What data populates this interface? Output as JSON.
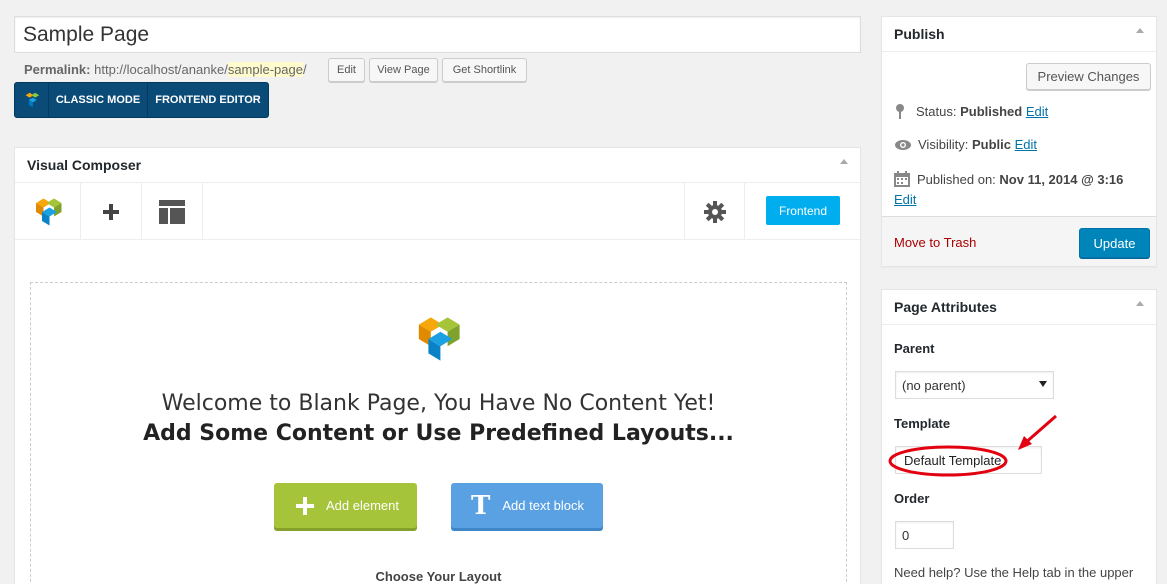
{
  "post": {
    "title": "Sample Page",
    "permalink_label": "Permalink:",
    "permalink_base": "http://localhost/ananke/",
    "permalink_slug": "sample-page",
    "permalink_end": "/",
    "edit_btn": "Edit",
    "view_btn": "View Page",
    "shortlink_btn": "Get Shortlink"
  },
  "mode_switch": {
    "classic": "CLASSIC MODE",
    "frontend": "FRONTEND EDITOR"
  },
  "vc": {
    "title": "Visual Composer",
    "frontend_btn": "Frontend",
    "welcome_line1": "Welcome to Blank Page, You Have No Content Yet!",
    "welcome_line2": "Add Some Content or Use Predefined Layouts...",
    "add_element": "Add element",
    "add_text_block": "Add text block",
    "choose_layout": "Choose Your Layout",
    "colors": {
      "add_element": "#a6c43a",
      "add_text": "#5aa1e3"
    }
  },
  "publish": {
    "title": "Publish",
    "preview_btn": "Preview Changes",
    "status_label": "Status:",
    "status_value": "Published",
    "visibility_label": "Visibility:",
    "visibility_value": "Public",
    "published_on_label": "Published on:",
    "published_on_value": "Nov 11, 2014 @ 3:16",
    "edit_link": "Edit",
    "trash_link": "Move to Trash",
    "update_btn": "Update"
  },
  "page_attributes": {
    "title": "Page Attributes",
    "parent_label": "Parent",
    "parent_value": "(no parent)",
    "template_label": "Template",
    "template_value": "Default Template",
    "order_label": "Order",
    "order_value": "0",
    "help_text": "Need help? Use the Help tab in the upper"
  }
}
